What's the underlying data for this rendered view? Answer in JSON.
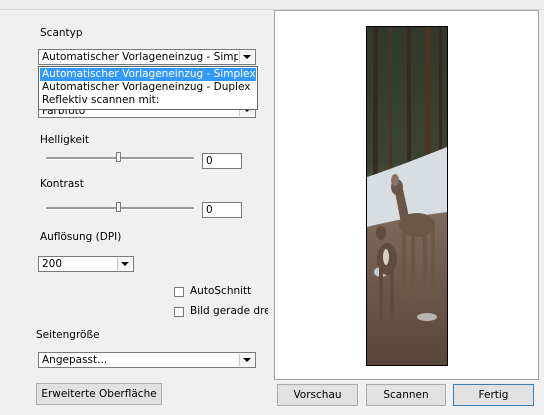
{
  "panel": {
    "scan_type_label": "Scantyp",
    "scan_type_value": "Automatischer Vorlageneinzug - Simpl",
    "scan_type_options": [
      "Automatischer Vorlageneinzug - Simplex",
      "Automatischer Vorlageneinzug - Duplex",
      "Reflektiv scannen mit:"
    ],
    "hidden_combo_partial": "Farbfoto",
    "brightness_label": "Helligkeit",
    "brightness_value": "0",
    "contrast_label": "Kontrast",
    "contrast_value": "0",
    "resolution_label": "Auflösung (DPI)",
    "resolution_value": "200",
    "autocrop_label": "AutoSchnitt",
    "deskew_label": "Bild gerade dre",
    "page_size_label": "Seitengröße",
    "page_size_value": "Angepasst..."
  },
  "buttons": {
    "advanced": "Erweiterte Oberfläche",
    "preview": "Vorschau",
    "scan": "Scannen",
    "done": "Fertig"
  },
  "colors": {
    "selection": "#3399ff",
    "window_bg": "#f0f0f0"
  }
}
